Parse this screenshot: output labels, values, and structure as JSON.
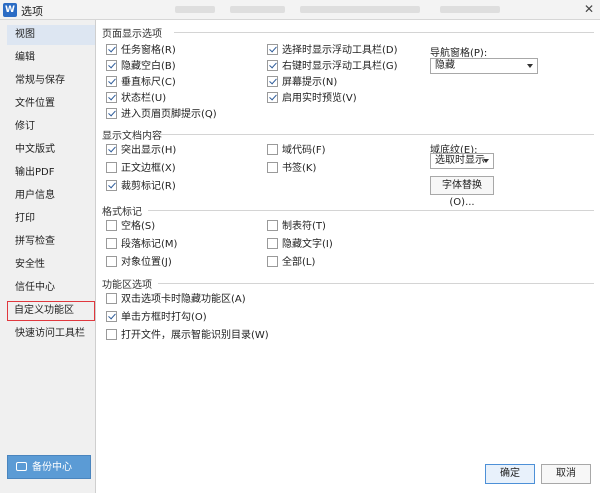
{
  "window": {
    "title": "选项"
  },
  "sidebar": {
    "items": [
      {
        "label": "视图"
      },
      {
        "label": "编辑"
      },
      {
        "label": "常规与保存"
      },
      {
        "label": "文件位置"
      },
      {
        "label": "修订"
      },
      {
        "label": "中文版式"
      },
      {
        "label": "输出PDF"
      },
      {
        "label": "用户信息"
      },
      {
        "label": "打印"
      },
      {
        "label": "拼写检查"
      },
      {
        "label": "安全性"
      },
      {
        "label": "信任中心"
      },
      {
        "label": "自定义功能区"
      },
      {
        "label": "快速访问工具栏"
      }
    ],
    "selected": "视图",
    "highlighted": "自定义功能区",
    "backup_label": "备份中心"
  },
  "page_display": {
    "title": "页面显示选项",
    "col1": [
      {
        "label": "任务窗格(R)",
        "checked": true
      },
      {
        "label": "隐藏空白(B)",
        "checked": true
      },
      {
        "label": "垂直标尺(C)",
        "checked": true
      },
      {
        "label": "状态栏(U)",
        "checked": true
      },
      {
        "label": "进入页眉页脚提示(Q)",
        "checked": true
      }
    ],
    "col2": [
      {
        "label": "选择时显示浮动工具栏(D)",
        "checked": true
      },
      {
        "label": "右键时显示浮动工具栏(G)",
        "checked": true
      },
      {
        "label": "屏幕提示(N)",
        "checked": true
      },
      {
        "label": "启用实时预览(V)",
        "checked": true
      }
    ],
    "nav_label": "导航窗格(P):",
    "nav_value": "隐藏"
  },
  "doc_content": {
    "title": "显示文档内容",
    "col1": [
      {
        "label": "突出显示(H)",
        "checked": true
      },
      {
        "label": "正文边框(X)",
        "checked": false
      },
      {
        "label": "裁剪标记(R)",
        "checked": true
      }
    ],
    "col2": [
      {
        "label": "域代码(F)",
        "checked": false
      },
      {
        "label": "书签(K)",
        "checked": false
      }
    ],
    "shading_label": "域底纹(E):",
    "shading_value": "选取时显示",
    "font_sub_button": "字体替换(O)..."
  },
  "format_marks": {
    "title": "格式标记",
    "col1": [
      {
        "label": "空格(S)",
        "checked": false
      },
      {
        "label": "段落标记(M)",
        "checked": false
      },
      {
        "label": "对象位置(J)",
        "checked": false
      }
    ],
    "col2": [
      {
        "label": "制表符(T)",
        "checked": false
      },
      {
        "label": "隐藏文字(I)",
        "checked": false
      },
      {
        "label": "全部(L)",
        "checked": false
      }
    ]
  },
  "ribbon_options": {
    "title": "功能区选项",
    "items": [
      {
        "label": "双击选项卡时隐藏功能区(A)",
        "checked": false
      },
      {
        "label": "单击方框时打勾(O)",
        "checked": true
      },
      {
        "label": "打开文件，展示智能识别目录(W)",
        "checked": false
      }
    ]
  },
  "footer": {
    "ok_label": "确定",
    "cancel_label": "取消"
  },
  "colors": {
    "accent": "#5b9bd5",
    "highlight_border": "#e0383e",
    "selected_bg": "#dde6f2"
  }
}
